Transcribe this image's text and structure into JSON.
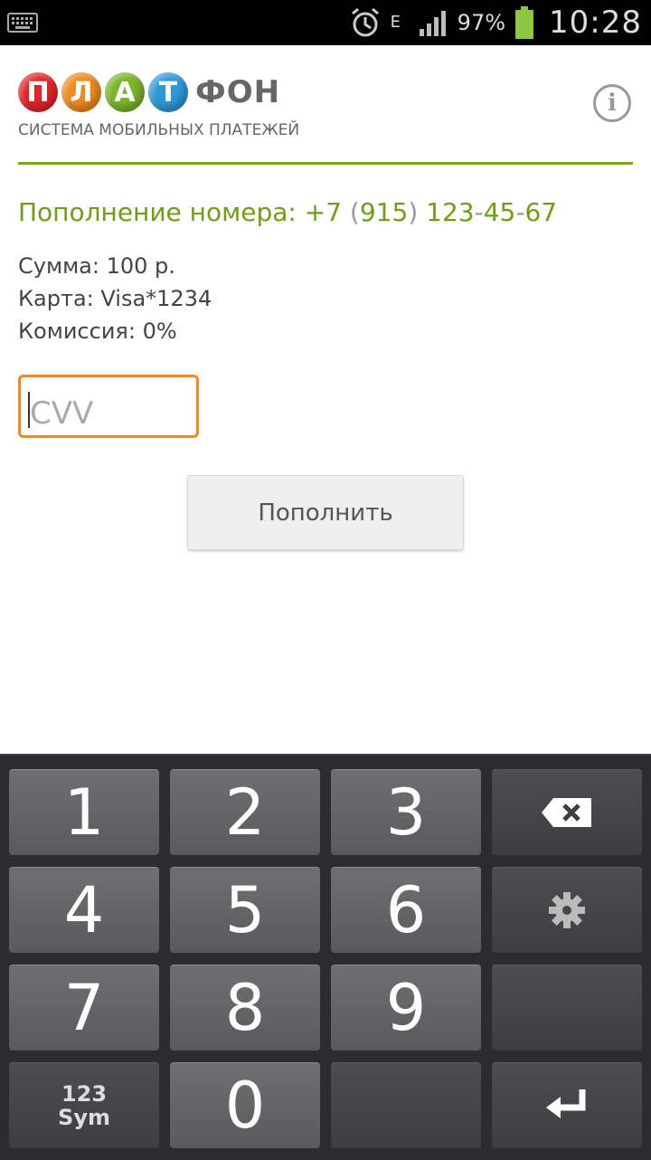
{
  "status_bar": {
    "battery_percent": "97%",
    "time": "10:28",
    "network_type": "E",
    "icons": [
      "keyboard-icon",
      "alarm-icon",
      "data-arrows-icon",
      "signal-icon",
      "battery-icon"
    ]
  },
  "header": {
    "logo_letters": [
      "П",
      "Л",
      "А",
      "Т"
    ],
    "logo_rest": "ФОН",
    "logo_subtitle": "СИСТЕМА МОБИЛЬНЫХ ПЛАТЕЖЕЙ",
    "info_glyph": "i"
  },
  "payment": {
    "title_prefix": "Пополнение номера: +7 ",
    "title_open": "(",
    "title_code": "915",
    "title_close": ")",
    "title_part1": " 123",
    "title_dash1": "-",
    "title_part2": "45",
    "title_dash2": "-",
    "title_part3": "67",
    "amount": "Сумма: 100 р.",
    "card": "Карта: Visa*1234",
    "commission": "Комиссия: 0%"
  },
  "cvv_input": {
    "placeholder": "CVV",
    "value": ""
  },
  "submit_label": "Пополнить",
  "keyboard": {
    "digits": [
      "1",
      "2",
      "3",
      "4",
      "5",
      "6",
      "7",
      "8",
      "9",
      "0"
    ],
    "sym_top": "123",
    "sym_bottom": "Sym"
  },
  "colors": {
    "accent_green": "#6e9e14",
    "input_border_orange": "#f08a1c",
    "logo_ball_colors": [
      "#e0252b",
      "#f08a1c",
      "#7ab52a",
      "#2c9ad8"
    ]
  }
}
